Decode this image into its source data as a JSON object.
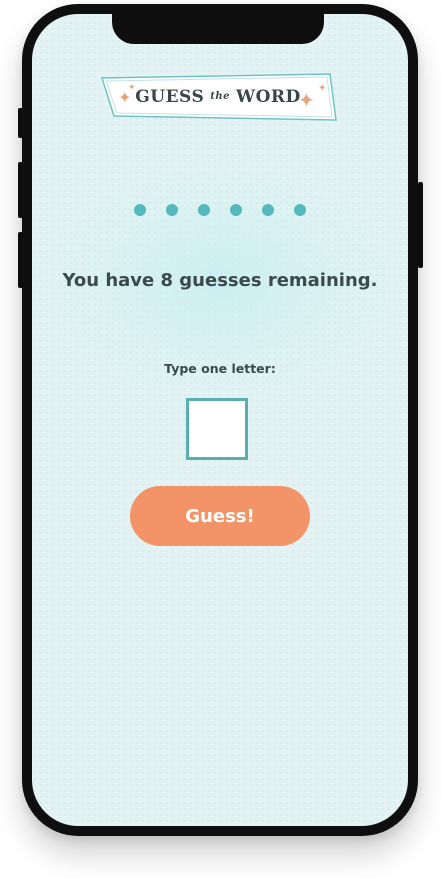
{
  "logo": {
    "word1": "Guess",
    "word_the": "the",
    "word2": "Word",
    "sparkle_icon": "sparkle-icon",
    "colors": {
      "banner_fill": "#ffffff",
      "banner_border": "#6fc3c6",
      "text": "#3a474a",
      "sparkle": "#e9a27a"
    }
  },
  "word_dots": {
    "count": 6,
    "color": "#55b9bd"
  },
  "status": {
    "remaining_text": "You have 8 guesses remaining."
  },
  "input": {
    "label": "Type one letter:",
    "value": "",
    "border_color": "#58aeb1"
  },
  "guess_button": {
    "label": "Guess!",
    "color": "#f29468"
  },
  "colors": {
    "screen_background": "#e3f3f4",
    "phone_frame": "#0f0f0f"
  }
}
